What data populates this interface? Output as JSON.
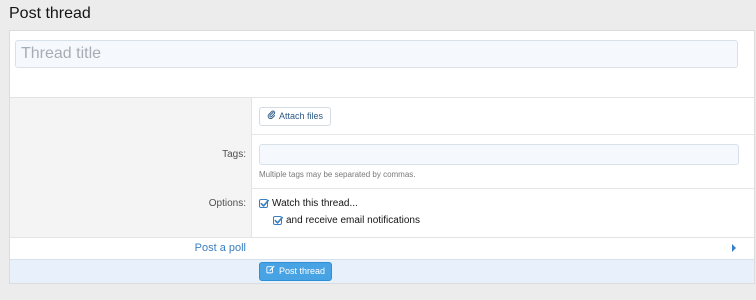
{
  "page": {
    "title": "Post thread"
  },
  "thread_title": {
    "placeholder": "Thread title",
    "value": ""
  },
  "attach": {
    "label": "Attach files",
    "icon": "paperclip-icon"
  },
  "tags": {
    "label": "Tags:",
    "value": "",
    "hint": "Multiple tags may be separated by commas."
  },
  "options": {
    "label": "Options:",
    "watch": {
      "label": "Watch this thread...",
      "checked": true
    },
    "email": {
      "label": "and receive email notifications",
      "checked": true
    }
  },
  "poll": {
    "label": "Post a poll"
  },
  "submit": {
    "label": "Post thread",
    "icon": "edit-icon"
  },
  "colors": {
    "accent": "#47a3e3",
    "link": "#3a7fc1",
    "input_bg": "#f5f9fd",
    "submit_row_bg": "#e8f1fb"
  }
}
